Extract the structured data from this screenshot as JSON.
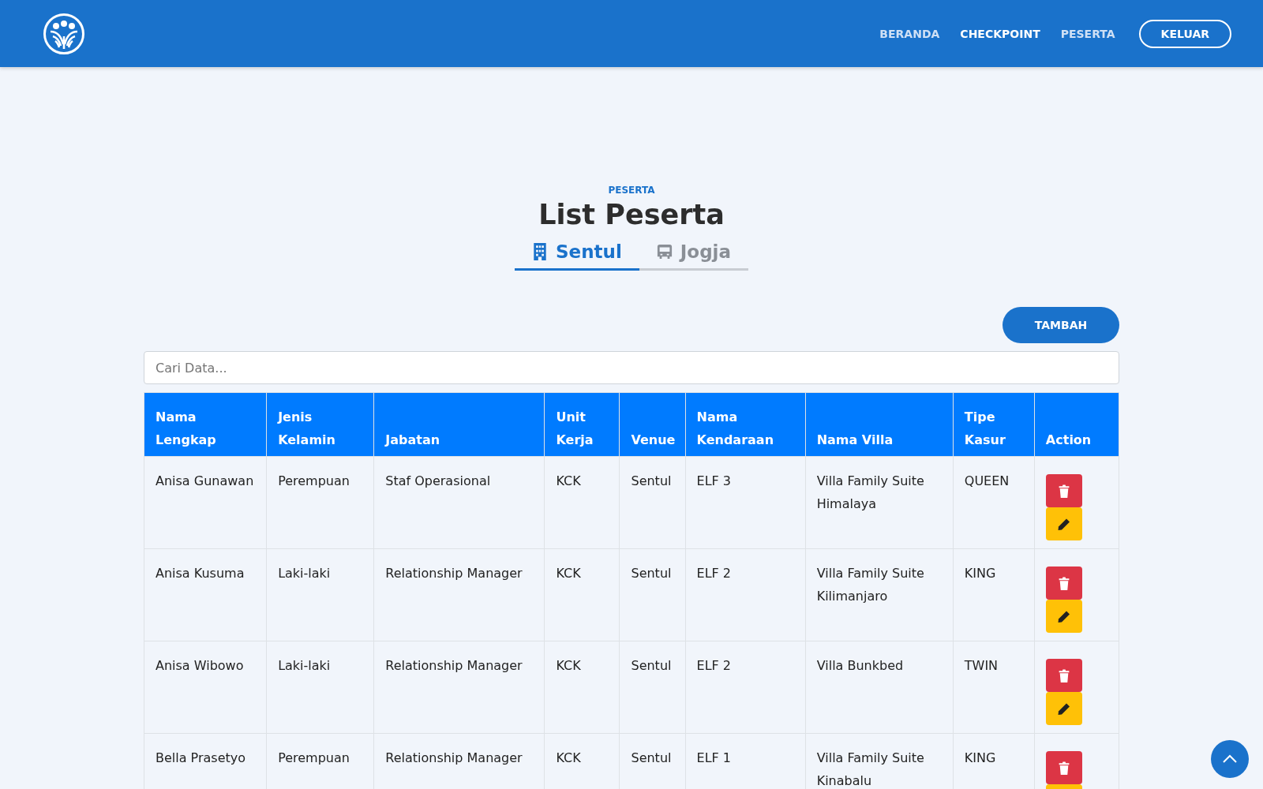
{
  "nav": {
    "items": [
      {
        "label": "BERANDA",
        "selected": false
      },
      {
        "label": "CHECKPOINT",
        "selected": true
      },
      {
        "label": "PESERTA",
        "selected": false
      }
    ],
    "logout": "KELUAR"
  },
  "header": {
    "eyebrow": "PESERTA",
    "title": "List Peserta"
  },
  "tabs": [
    {
      "label": "Sentul",
      "kind": "building",
      "selected": true
    },
    {
      "label": "Jogja",
      "kind": "bus",
      "selected": false
    }
  ],
  "add_button": "TAMBAH",
  "search": {
    "placeholder": "Cari Data..."
  },
  "table": {
    "columns": [
      "Nama Lengkap",
      "Jenis Kelamin",
      "Jabatan",
      "Unit Kerja",
      "Venue",
      "Nama Kendaraan",
      "Nama Villa",
      "Tipe Kasur",
      "Action"
    ],
    "rows": [
      {
        "cells": [
          "Anisa Gunawan",
          "Perempuan",
          "Staf Operasional",
          "KCK",
          "Sentul",
          "ELF 3",
          "Villa Family Suite Himalaya",
          "QUEEN"
        ]
      },
      {
        "cells": [
          "Anisa Kusuma",
          "Laki-laki",
          "Relationship Manager",
          "KCK",
          "Sentul",
          "ELF 2",
          "Villa Family Suite Kilimanjaro",
          "KING"
        ]
      },
      {
        "cells": [
          "Anisa Wibowo",
          "Laki-laki",
          "Relationship Manager",
          "KCK",
          "Sentul",
          "ELF 2",
          "Villa Bunkbed",
          "TWIN"
        ]
      },
      {
        "cells": [
          "Bella Prasetyo",
          "Perempuan",
          "Relationship Manager",
          "KCK",
          "Sentul",
          "ELF 1",
          "Villa Family Suite Kinabalu",
          "KING"
        ]
      }
    ]
  }
}
